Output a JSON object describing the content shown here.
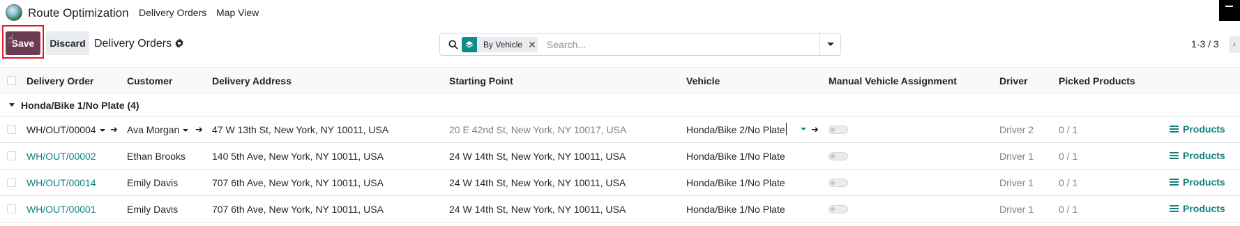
{
  "navbar": {
    "app_name": "Route Optimization",
    "menu": [
      "Delivery Orders",
      "Map View"
    ],
    "logo_icon": "globe-logo"
  },
  "control_panel": {
    "save_label": "Save",
    "discard_label": "Discard",
    "breadcrumb": "Delivery Orders",
    "search": {
      "facet_label": "By Vehicle",
      "facet_icon": "layers-icon",
      "placeholder": "Search..."
    },
    "pager": "1-3 / 3"
  },
  "table": {
    "columns": [
      "Delivery Order",
      "Customer",
      "Delivery Address",
      "Starting Point",
      "Vehicle",
      "Manual Vehicle Assignment",
      "Driver",
      "Picked Products"
    ],
    "group": {
      "label": "Honda/Bike 1/No Plate (4)"
    },
    "rows": [
      {
        "order": "WH/OUT/00004",
        "customer": "Ava Morgan",
        "address": "47 W 13th St, New York, NY 10011, USA",
        "start": "20 E 42nd St, New York, NY 10017, USA",
        "vehicle": "Honda/Bike 2/No Plate",
        "driver": "Driver 2",
        "picked": "0 / 1",
        "products": "Products"
      },
      {
        "order": "WH/OUT/00002",
        "customer": "Ethan Brooks",
        "address": "140 5th Ave, New York, NY 10011, USA",
        "start": "24 W 14th St, New York, NY 10011, USA",
        "vehicle": "Honda/Bike 1/No Plate",
        "driver": "Driver 1",
        "picked": "0 / 1",
        "products": "Products"
      },
      {
        "order": "WH/OUT/00014",
        "customer": "Emily Davis",
        "address": "707 6th Ave, New York, NY 10011, USA",
        "start": "24 W 14th St, New York, NY 10011, USA",
        "vehicle": "Honda/Bike 1/No Plate",
        "driver": "Driver 1",
        "picked": "0 / 1",
        "products": "Products"
      },
      {
        "order": "WH/OUT/00001",
        "customer": "Emily Davis",
        "address": "707 6th Ave, New York, NY 10011, USA",
        "start": "24 W 14th St, New York, NY 10011, USA",
        "vehicle": "Honda/Bike 1/No Plate",
        "driver": "Driver 1",
        "picked": "0 / 1",
        "products": "Products"
      }
    ]
  },
  "colors": {
    "primary": "#6b3a53",
    "link": "#12807f",
    "highlight": "#e8171f",
    "facet": "#0d8c8c"
  }
}
